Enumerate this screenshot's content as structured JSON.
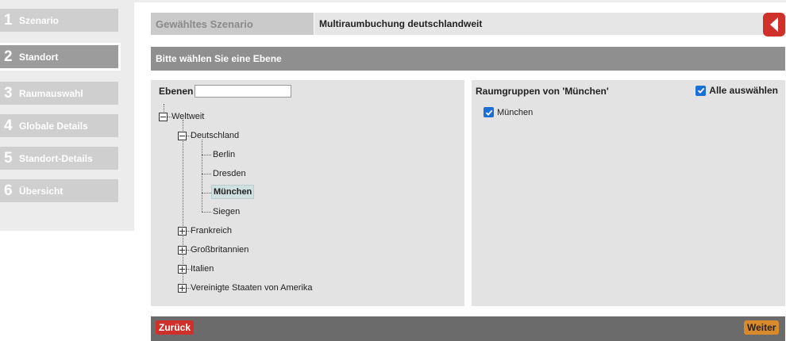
{
  "steps": [
    {
      "num": "1",
      "label": "Szenario"
    },
    {
      "num": "2",
      "label": "Standort"
    },
    {
      "num": "3",
      "label": "Raumauswahl"
    },
    {
      "num": "4",
      "label": "Globale Details"
    },
    {
      "num": "5",
      "label": "Standort-Details"
    },
    {
      "num": "6",
      "label": "Übersicht"
    }
  ],
  "active_step": "2",
  "header": {
    "label": "Gewähltes Szenario",
    "value": "Multiraumbuchung deutschlandweit",
    "back_icon": "chevron-left-icon"
  },
  "section_title": "Bitte wählen Sie eine Ebene",
  "tree": {
    "filter_label": "Ebenen",
    "filter_value": "",
    "root": "Weltweit",
    "country_expanded": "Deutschland",
    "cities": [
      "Berlin",
      "Dresden",
      "München",
      "Siegen"
    ],
    "selected_city": "München",
    "collapsed_countries": [
      "Frankreich",
      "Großbritannien",
      "Italien",
      "Vereinigte Staaten von Amerika"
    ]
  },
  "room_groups": {
    "title": "Raumgruppen von 'München'",
    "select_all_label": "Alle auswählen",
    "select_all_checked": true,
    "items": [
      {
        "label": "München",
        "checked": true
      }
    ]
  },
  "footer": {
    "back_label": "Zurück",
    "next_label": "Weiter"
  },
  "colors": {
    "accent_red": "#d0302a",
    "accent_orange": "#d88a2c",
    "checkbox_blue": "#1a6fd6"
  }
}
